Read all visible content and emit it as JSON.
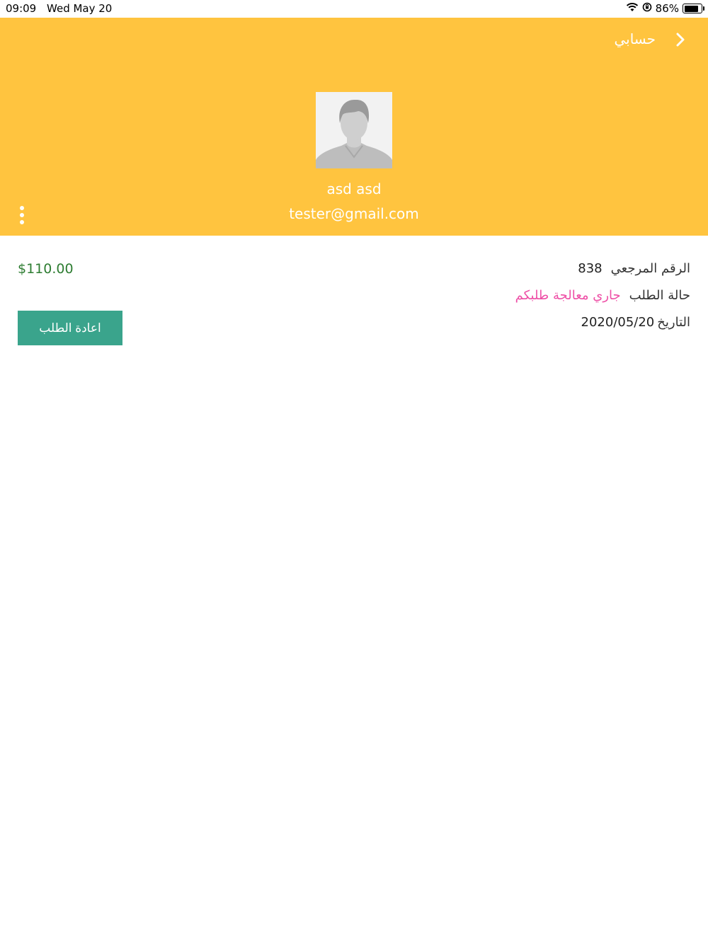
{
  "status_bar": {
    "time": "09:09",
    "date": "Wed May 20",
    "battery_percent": "86%",
    "battery_level": 0.86
  },
  "header": {
    "title": "حسابي",
    "background_color": "#ffc43f"
  },
  "profile": {
    "name": "asd asd",
    "email": "tester@gmail.com"
  },
  "order": {
    "ref_label": "الرقم المرجعي",
    "ref_value": "838",
    "status_label": "حالة الطلب",
    "status_value": "جاري معالجة طلبكم",
    "status_color": "#ee4fa6",
    "date_label": "التاريخ",
    "date_value": "2020/05/20",
    "price": "$110.00",
    "price_color": "#2e7d32",
    "reorder_label": "اعادة الطلب",
    "reorder_color": "#3aa48c"
  }
}
